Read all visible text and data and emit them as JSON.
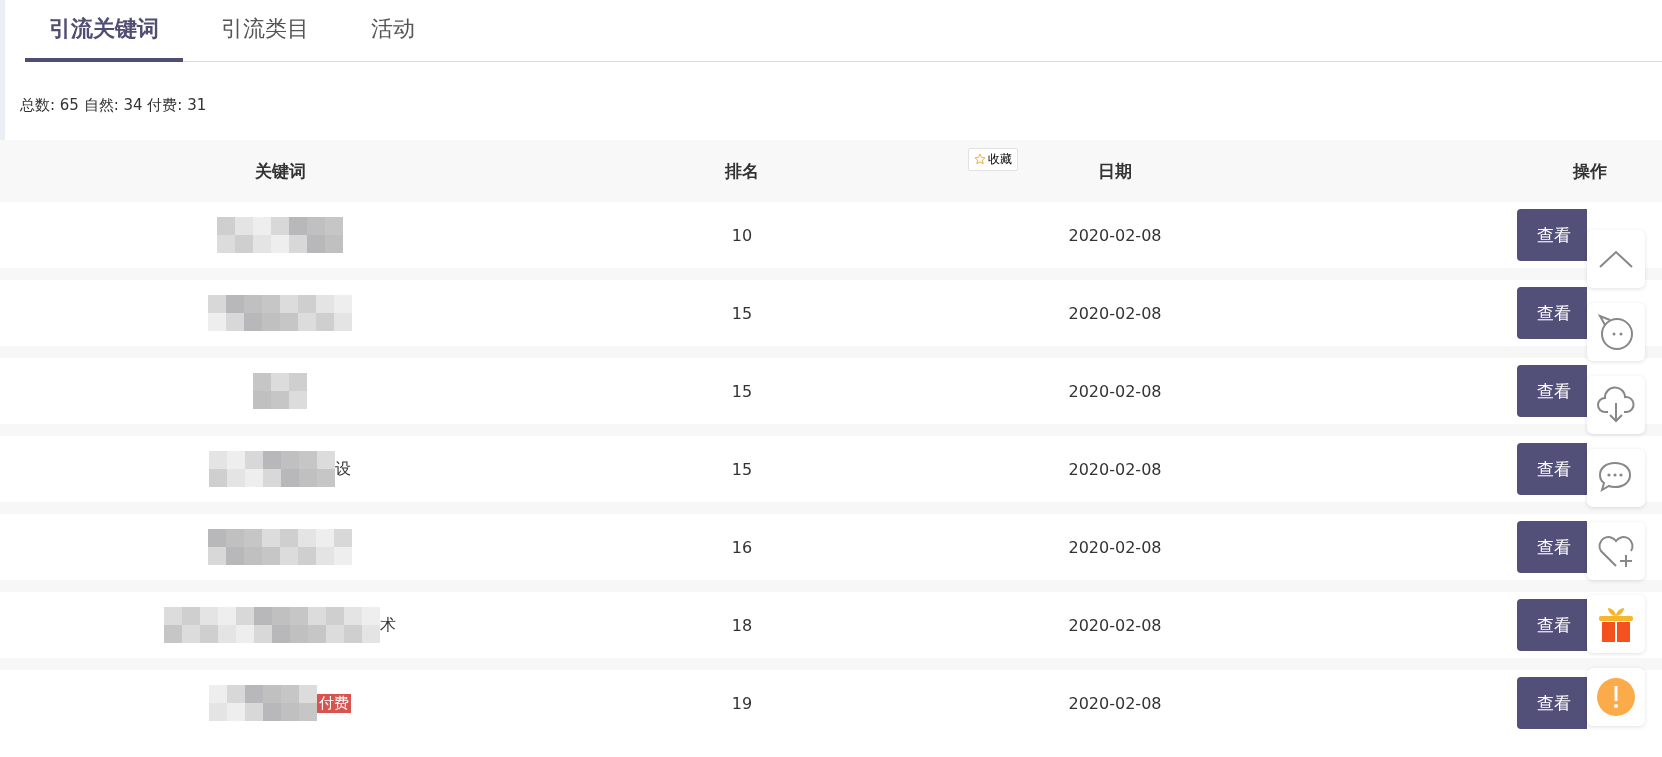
{
  "tabs": [
    {
      "label": "引流关键词",
      "selected": true
    },
    {
      "label": "引流类目",
      "selected": false
    },
    {
      "label": "活动",
      "selected": false
    }
  ],
  "summary": "总数: 65 自然: 34 付费: 31",
  "table": {
    "columns": [
      "关键词",
      "排名",
      "日期",
      "操作"
    ],
    "favorite_button": "收藏",
    "rows": [
      {
        "rank": "10",
        "date": "2020-02-08",
        "action": "查看"
      },
      {
        "rank": "15",
        "date": "2020-02-08",
        "action": "查看"
      },
      {
        "rank": "15",
        "date": "2020-02-08",
        "action": "查看"
      },
      {
        "keyword": {
          "kind": "picture",
          "tail": "设"
        },
        "rank": "15",
        "date": "2020-02-08",
        "action": "查看"
      },
      {
        "rank": "16",
        "date": "2020-02-08",
        "action": "查看"
      },
      {
        "keyword": {
          "kind": "picture",
          "tail": "术"
        },
        "rank": "18",
        "date": "2020-02-08",
        "action": "查看"
      },
      {
        "keyword": {
          "kind": "picture",
          "badge": "付费"
        },
        "rank": "19",
        "date": "2020-02-08",
        "action": "查看"
      }
    ]
  }
}
